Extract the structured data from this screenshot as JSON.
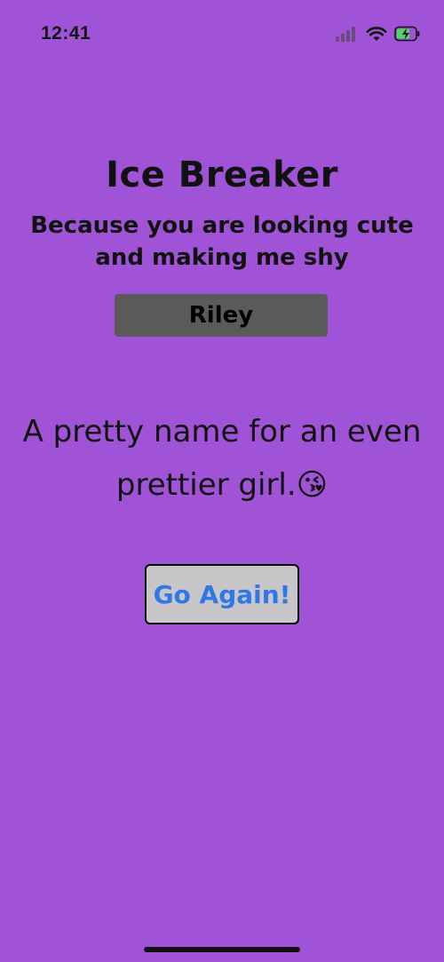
{
  "status_bar": {
    "time": "12:41",
    "icons": [
      "cellular-signal-icon",
      "wifi-icon",
      "battery-charging-icon"
    ]
  },
  "app": {
    "title": "Ice Breaker",
    "subtitle": "Because you are looking cute and making me shy",
    "name": "Riley",
    "message": "A pretty name for an even prettier girl.😘",
    "button_label": "Go Again!"
  },
  "colors": {
    "background": "#a053d6",
    "name_box": "#5b5a5b",
    "button_background": "#c8c6c9",
    "button_text": "#2f78e6",
    "battery_fill": "#4cd964"
  }
}
